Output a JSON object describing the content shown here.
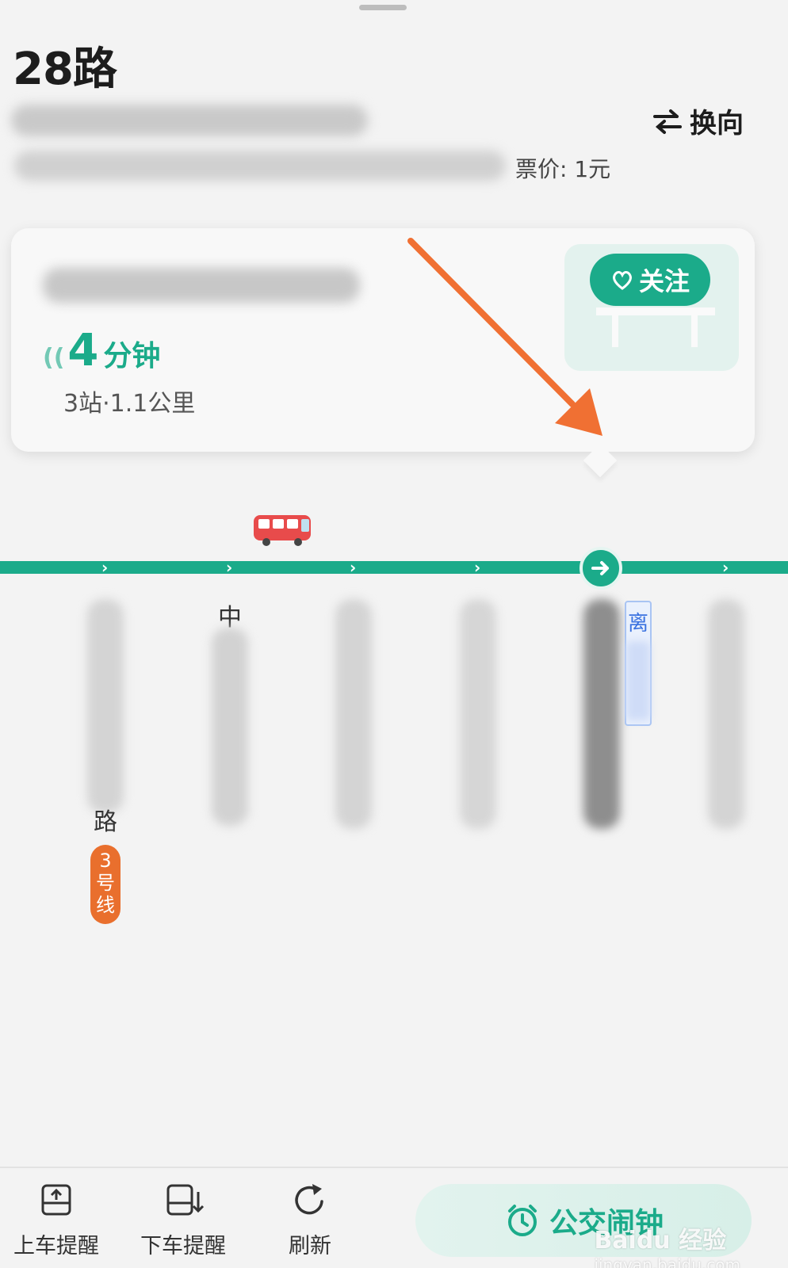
{
  "header": {
    "route_name": "28路",
    "switch_direction_label": "换向",
    "fare_label": "票价: 1元"
  },
  "arrival_card": {
    "follow_label": "关注",
    "eta_number": "4",
    "eta_unit": "分钟",
    "eta_detail": "3站·1.1公里"
  },
  "stations": {
    "labels": [
      "中",
      "路"
    ],
    "leave_tag": "离",
    "metro_badge": "3号线"
  },
  "bottom_bar": {
    "board_reminder": "上车提醒",
    "alight_reminder": "下车提醒",
    "refresh": "刷新",
    "bus_alarm": "公交闹钟"
  },
  "watermark": {
    "brand": "Baidu 经验",
    "url": "jingyan.baidu.com"
  },
  "colors": {
    "accent": "#1bab8a",
    "annotation_arrow": "#f07033",
    "metro_badge": "#e96f2d"
  }
}
